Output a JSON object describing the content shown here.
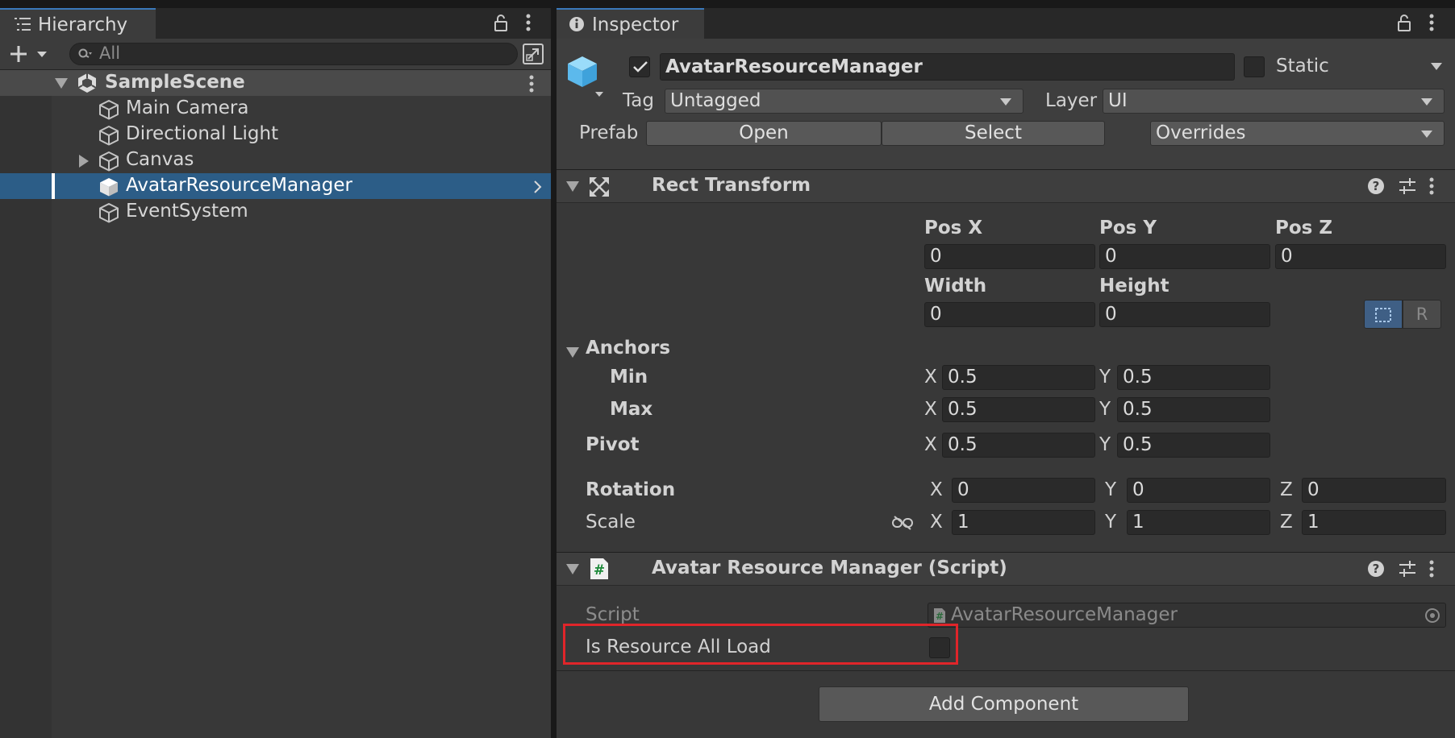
{
  "hierarchy": {
    "tab_title": "Hierarchy",
    "search_placeholder": "All",
    "scene": {
      "name": "SampleScene"
    },
    "items": [
      {
        "name": "Main Camera"
      },
      {
        "name": "Directional Light"
      },
      {
        "name": "Canvas"
      },
      {
        "name": "AvatarResourceManager"
      },
      {
        "name": "EventSystem"
      }
    ]
  },
  "inspector": {
    "tab_title": "Inspector",
    "object": {
      "name": "AvatarResourceManager",
      "static_label": "Static",
      "tag_label": "Tag",
      "tag_value": "Untagged",
      "layer_label": "Layer",
      "layer_value": "UI",
      "prefab_label": "Prefab",
      "open_label": "Open",
      "select_label": "Select",
      "overrides_label": "Overrides"
    },
    "rect_transform": {
      "title": "Rect Transform",
      "pos_x_label": "Pos X",
      "pos_x": "0",
      "pos_y_label": "Pos Y",
      "pos_y": "0",
      "pos_z_label": "Pos Z",
      "pos_z": "0",
      "width_label": "Width",
      "width": "0",
      "height_label": "Height",
      "height": "0",
      "raw_button": "R",
      "anchors_label": "Anchors",
      "min_label": "Min",
      "min_x": "0.5",
      "min_y": "0.5",
      "max_label": "Max",
      "max_x": "0.5",
      "max_y": "0.5",
      "pivot_label": "Pivot",
      "pivot_x": "0.5",
      "pivot_y": "0.5",
      "rotation_label": "Rotation",
      "rot_x": "0",
      "rot_y": "0",
      "rot_z": "0",
      "scale_label": "Scale",
      "scale_x": "1",
      "scale_y": "1",
      "scale_z": "1",
      "axis_x": "X",
      "axis_y": "Y",
      "axis_z": "Z"
    },
    "script_component": {
      "title": "Avatar Resource Manager (Script)",
      "script_label": "Script",
      "script_value": "AvatarResourceManager",
      "field_label": "Is Resource All Load",
      "field_checked": false
    },
    "add_component_label": "Add Component"
  },
  "colors": {
    "selection": "#2c5d87",
    "accent": "#3a79bb",
    "highlight_box": "#e0252a",
    "cube_blue": "#6ec6f2"
  }
}
